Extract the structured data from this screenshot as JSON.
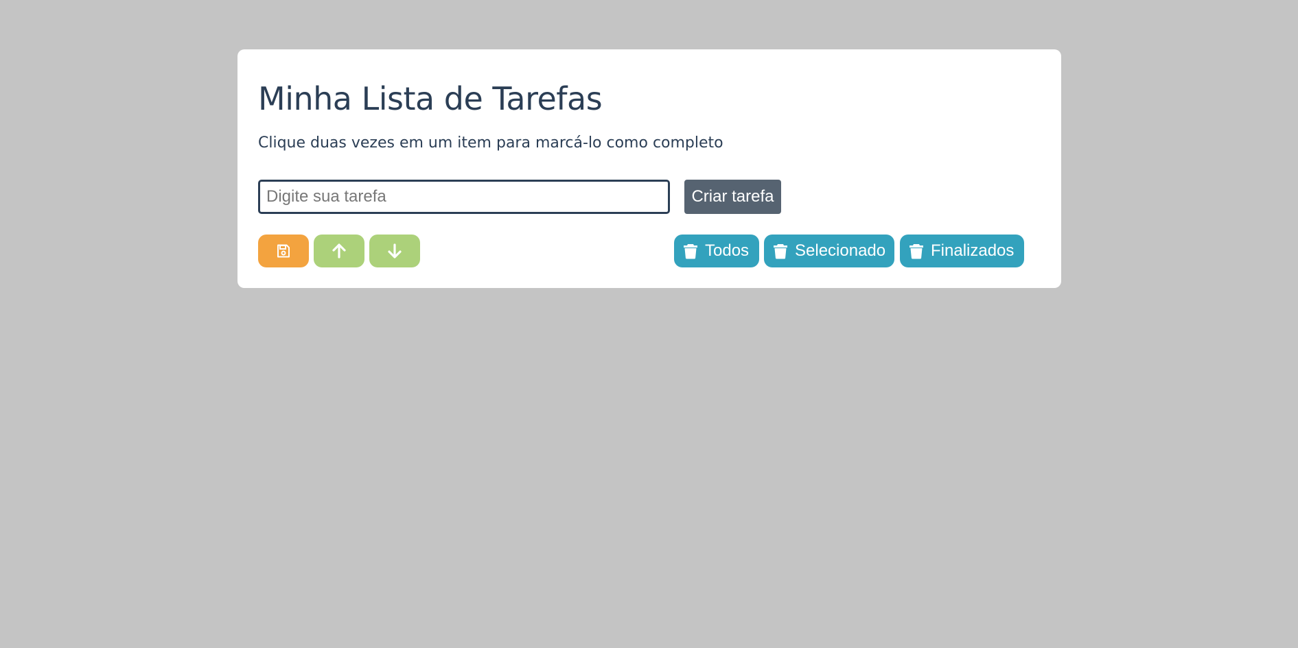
{
  "header": {
    "title": "Minha Lista de Tarefas",
    "subtitle": "Clique duas vezes em um item para marcá-lo como completo"
  },
  "task_form": {
    "input_value": "",
    "input_placeholder": "Digite sua tarefa",
    "create_label": "Criar tarefa"
  },
  "toolbar": {
    "save_icon": "floppy-disk-icon",
    "move_up_icon": "arrow-up-icon",
    "move_down_icon": "arrow-down-icon",
    "delete_icon": "trash-icon",
    "delete_all_label": "Todos",
    "delete_selected_label": "Selecionado",
    "delete_finished_label": "Finalizados"
  },
  "colors": {
    "background": "#c4c4c4",
    "text": "#2b3e55",
    "save": "#f3a33f",
    "move": "#acd17a",
    "delete": "#33a2bd",
    "create": "#566371"
  }
}
